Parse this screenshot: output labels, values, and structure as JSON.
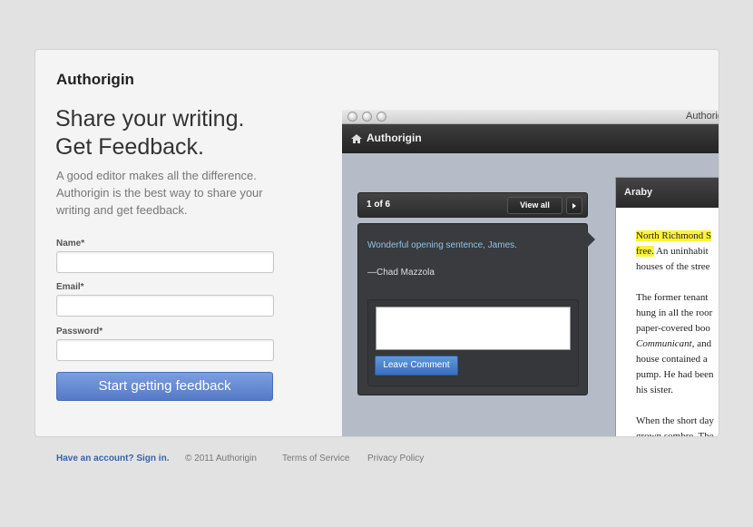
{
  "brand": "Authorigin",
  "headline": [
    "Share your writing.",
    "Get Feedback."
  ],
  "tagline": "A good editor makes all the difference. Authorigin is the best way to share your writing and get feedback.",
  "form": {
    "name_label": "Name*",
    "email_label": "Email*",
    "password_label": "Password*",
    "submit_label": "Start getting feedback"
  },
  "preview": {
    "window_title": "Authorig",
    "app_name": "Authorigin",
    "counter": "1 of 6",
    "view_all": "View all",
    "comment_text": "Wonderful opening sentence, James.",
    "comment_author": "—Chad Mazzola",
    "leave_comment": "Leave Comment",
    "doc_title": "Araby",
    "doc_lines": {
      "l1_hl": "North Richmond S",
      "l2_hl": "free.",
      "l2_rest": " An uninhabit",
      "l3": "houses of the stree",
      "l5": "The former tenant",
      "l6": "hung in all the roor",
      "l7": "paper-covered boo",
      "l8_it": "Communicant",
      "l8_rest": ", and",
      "l9": "house contained a",
      "l10": "pump. He had been",
      "l11": "his sister.",
      "l13": "When the short day",
      "l14": "grown sombre. The"
    }
  },
  "footer": {
    "signin": "Have an account? Sign in.",
    "copyright": "© 2011 Authorigin",
    "terms": "Terms of Service",
    "privacy": "Privacy Policy"
  }
}
